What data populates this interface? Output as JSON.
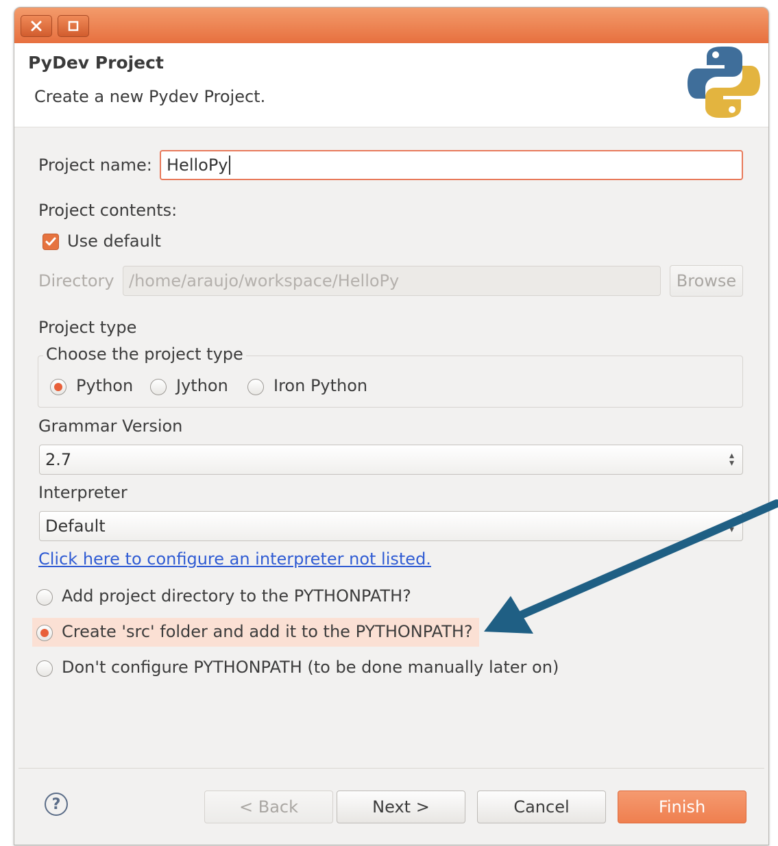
{
  "dialog": {
    "title": "PyDev Project",
    "subtitle": "Create a new Pydev Project."
  },
  "project_name": {
    "label": "Project name:",
    "value": "HelloPy"
  },
  "contents": {
    "label": "Project contents:",
    "use_default_label": "Use default",
    "use_default_checked": true,
    "directory_label": "Directory",
    "directory_value": "/home/araujo/workspace/HelloPy",
    "browse_label": "Browse"
  },
  "project_type": {
    "label": "Project type",
    "group_label": "Choose the project type",
    "options": [
      "Python",
      "Jython",
      "Iron Python"
    ],
    "selected": "Python"
  },
  "grammar": {
    "label": "Grammar Version",
    "value": "2.7"
  },
  "interpreter": {
    "label": "Interpreter",
    "value": "Default",
    "configure_link": "Click here to configure an interpreter not listed."
  },
  "pythonpath": {
    "options": [
      "Add project directory to the PYTHONPATH?",
      "Create 'src' folder and add it to the PYTHONPATH?",
      "Don't configure PYTHONPATH (to be done manually later on)"
    ],
    "selected_index": 1
  },
  "buttons": {
    "help": "?",
    "back": "< Back",
    "next": "Next >",
    "cancel": "Cancel",
    "finish": "Finish"
  },
  "colors": {
    "accent": "#e8603a",
    "titlebar": "#ec7a48",
    "arrow": "#1f5f84",
    "highlight": "#fbe0d4",
    "link": "#2f5bd3"
  },
  "icons": [
    "close-icon",
    "maximize-icon",
    "python-logo",
    "help-icon",
    "checkmark-icon"
  ]
}
